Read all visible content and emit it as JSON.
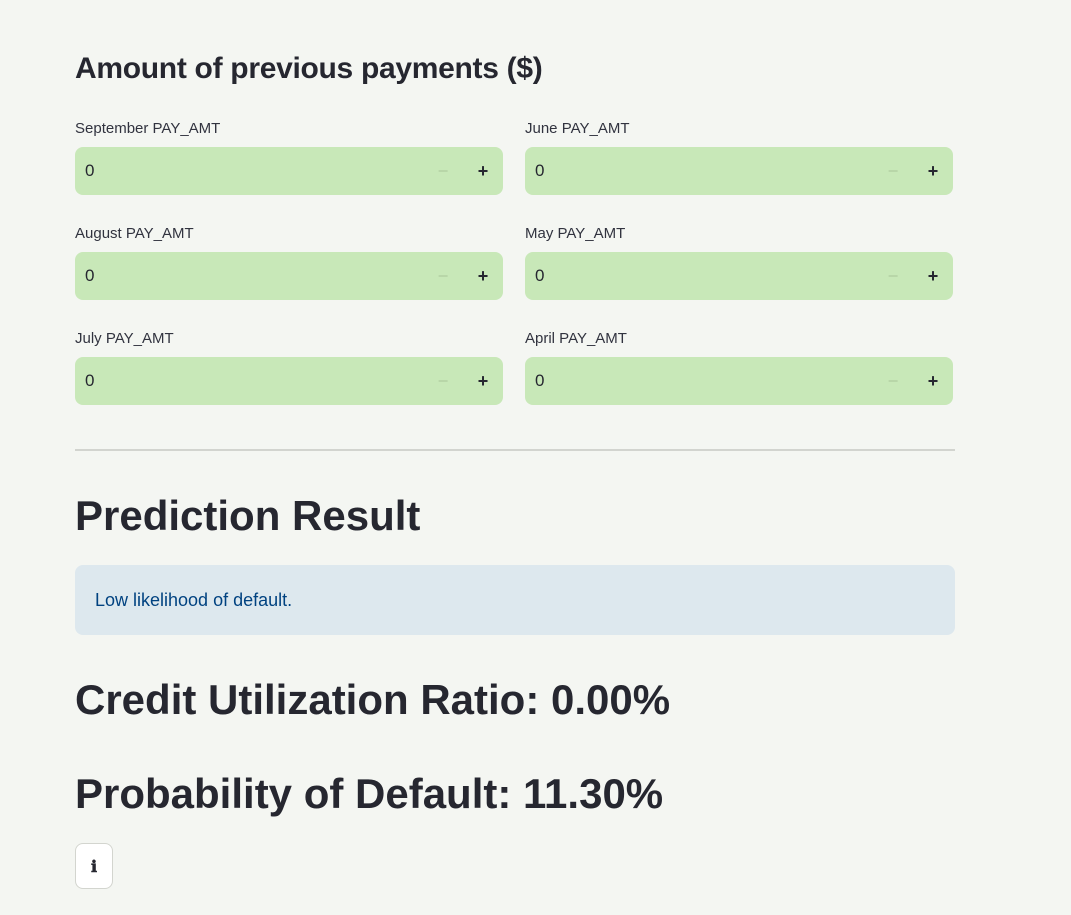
{
  "payments_section": {
    "heading": "Amount of previous payments ($)",
    "fields": [
      {
        "label": "September PAY_AMT",
        "value": "0"
      },
      {
        "label": "June PAY_AMT",
        "value": "0"
      },
      {
        "label": "August PAY_AMT",
        "value": "0"
      },
      {
        "label": "May PAY_AMT",
        "value": "0"
      },
      {
        "label": "July PAY_AMT",
        "value": "0"
      },
      {
        "label": "April PAY_AMT",
        "value": "0"
      }
    ],
    "minus_glyph": "−",
    "plus_glyph": "+"
  },
  "result": {
    "heading": "Prediction Result",
    "message": "Low likelihood of default.",
    "credit_utilization": "Credit Utilization Ratio: 0.00%",
    "probability_default": "Probability of Default: 11.30%",
    "info_button_icon": "info-icon",
    "info_button_glyph": "ℹ"
  },
  "colors": {
    "background": "#f4f6f2",
    "input_background": "#c8e8b8",
    "info_box_background": "#dde8ee",
    "info_text": "#004280"
  }
}
